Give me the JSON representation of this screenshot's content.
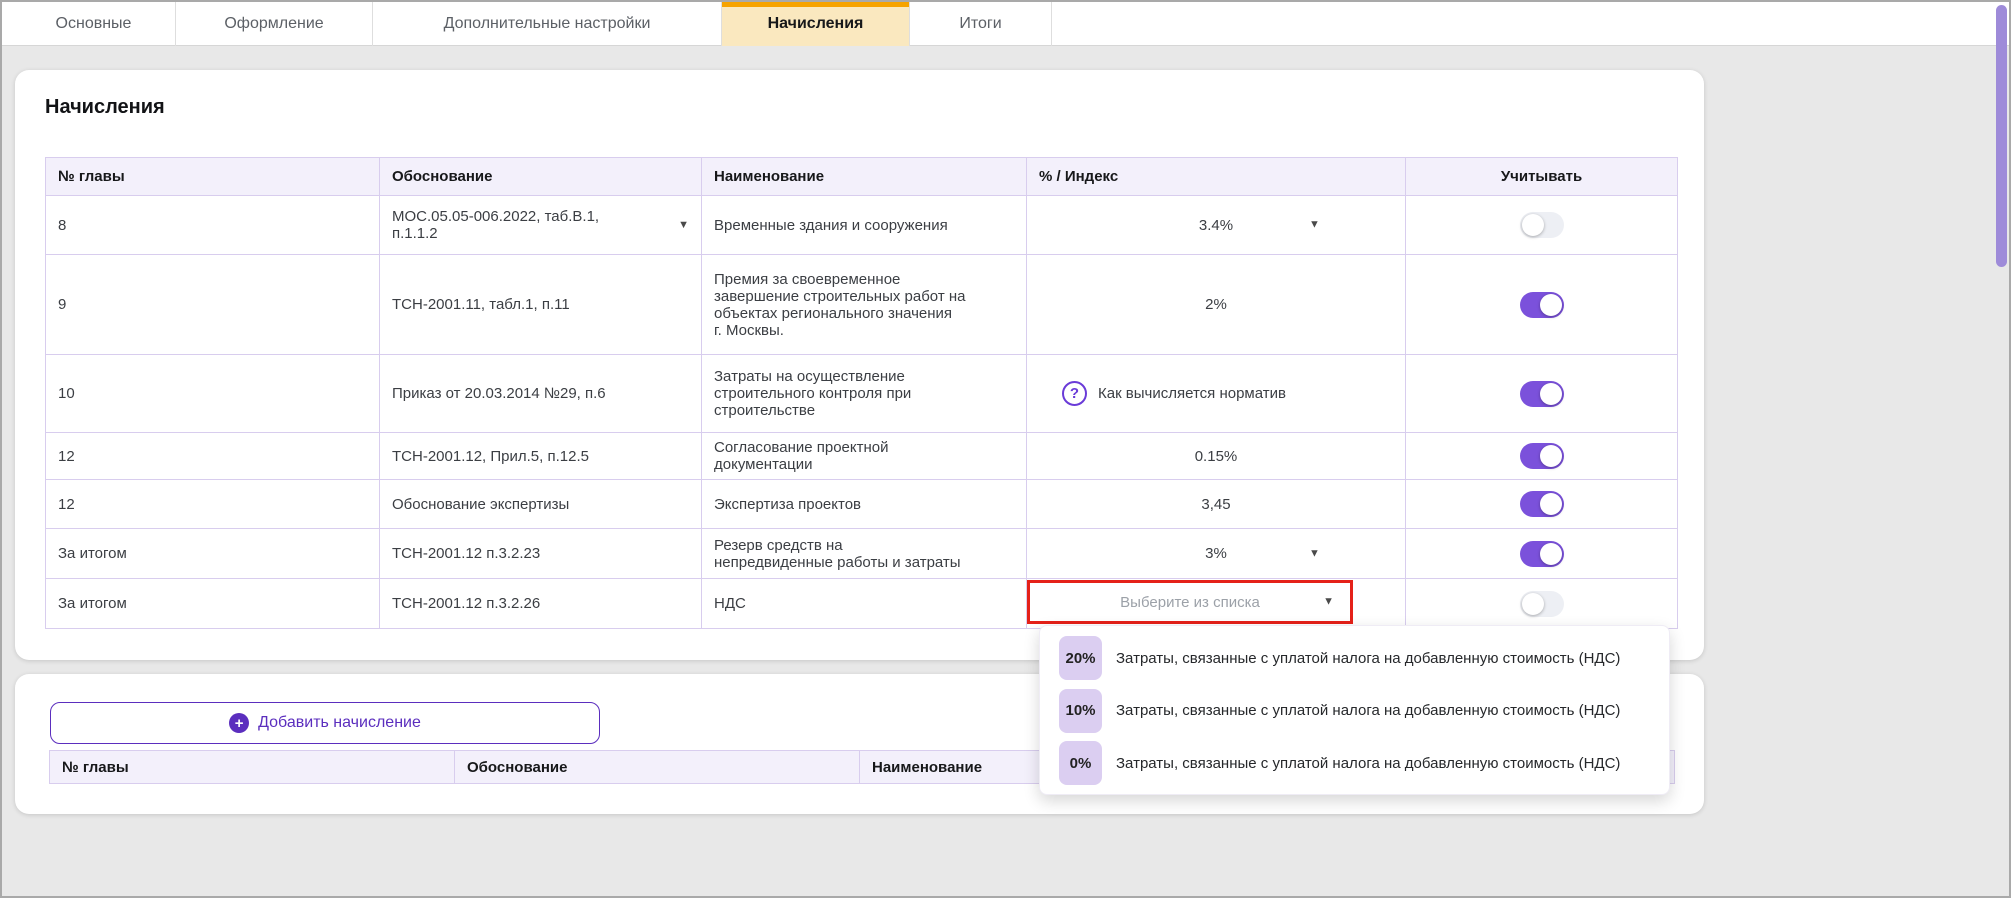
{
  "colors": {
    "accent_purple": "#6a3bd8",
    "button_purple": "#5b2ebe",
    "toggle_on": "#7b51db",
    "active_tab_bg": "#fae8bf",
    "active_tab_top": "#f6a300",
    "highlight_red": "#e52119",
    "badge_bg": "#dbcef1",
    "header_row_bg": "#f3f0fb",
    "table_border": "#d8cdee",
    "scrollbar": "#9e8bd9"
  },
  "tabs": [
    {
      "label": "Основные",
      "active": false
    },
    {
      "label": "Оформление",
      "active": false
    },
    {
      "label": "Дополнительные настройки",
      "active": false
    },
    {
      "label": "Начисления",
      "active": true
    },
    {
      "label": "Итоги",
      "active": false
    }
  ],
  "card1": {
    "title": "Начисления",
    "table": {
      "headers": [
        "№ главы",
        "Обоснование",
        "Наименование",
        "% / Индекс",
        "Учитывать"
      ],
      "rows": [
        {
          "chapter": "8",
          "basis": "МОС.05.05-006.2022, таб.В.1,\nп.1.1.2",
          "basis_has_caret": true,
          "name": "Временные здания и сооружения",
          "value": "3.4%",
          "value_has_caret": true,
          "checked": false
        },
        {
          "chapter": "9",
          "basis": "ТСН-2001.11, табл.1, п.11",
          "name": "Премия за своевременное\nзавершение строительных работ на\nобъектах регионального значения\nг. Москвы.",
          "value": "2%",
          "checked": true
        },
        {
          "chapter": "10",
          "basis": "Приказ от 20.03.2014 №29, п.6",
          "name": "Затраты на осуществление\nстроительного контроля при\nстроительстве",
          "help_text": "Как вычисляется норматив",
          "help_icon": "question-circle",
          "checked": true
        },
        {
          "chapter": "12",
          "basis": "ТСН-2001.12, Прил.5, п.12.5",
          "name": "Согласование проектной\nдокументации",
          "value": "0.15%",
          "checked": true
        },
        {
          "chapter": "12",
          "basis": "Обоснование экспертизы",
          "name": "Экспертиза проектов",
          "value": "3,45",
          "checked": true
        },
        {
          "chapter": "За итогом",
          "basis": "ТСН-2001.12 п.3.2.23",
          "name": "Резерв средств на\nнепредвиденные работы и затраты",
          "value": "3%",
          "value_has_caret": true,
          "checked": true
        },
        {
          "chapter": "За итогом",
          "basis": "ТСН-2001.12 п.3.2.26",
          "name": "НДС",
          "placeholder": "Выберите из списка",
          "highlighted": true,
          "checked": false
        }
      ]
    }
  },
  "dropdown": {
    "options": [
      {
        "badge": "20%",
        "label": "Затраты, связанные с уплатой налога на добавленную стоимость (НДС)"
      },
      {
        "badge": "10%",
        "label": "Затраты, связанные с уплатой налога на добавленную стоимость (НДС)"
      },
      {
        "badge": "0%",
        "label": "Затраты, связанные с уплатой налога на добавленную стоимость (НДС)"
      }
    ]
  },
  "card2": {
    "add_button_label": "Добавить начисление",
    "headers": [
      "№ главы",
      "Обоснование",
      "Наименование"
    ]
  }
}
